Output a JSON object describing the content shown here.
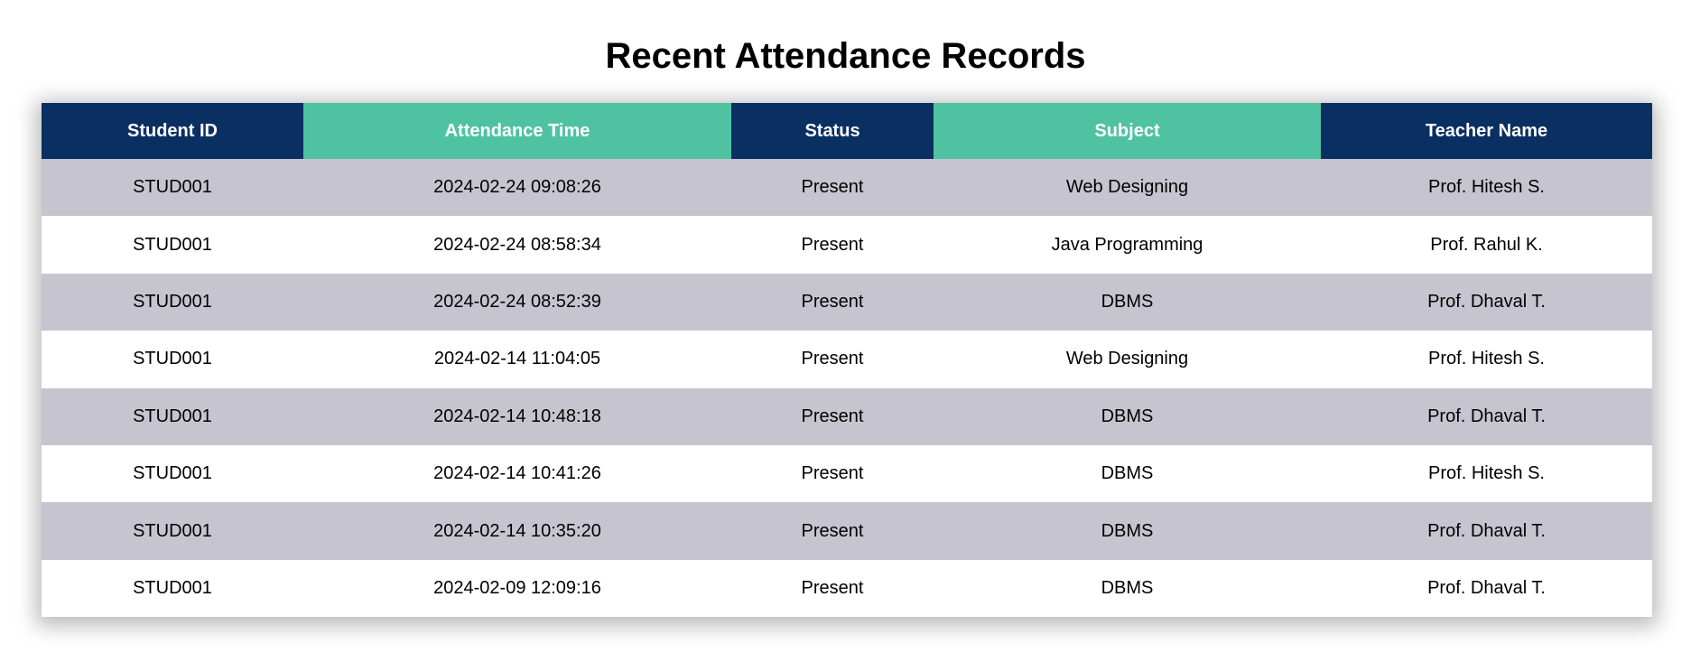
{
  "page": {
    "title": "Recent Attendance Records"
  },
  "colors": {
    "header_dark": "#0a2f63",
    "header_teal": "#4fc3a1",
    "row_shaded": "#c6c5cf",
    "row_plain": "#ffffff"
  },
  "table": {
    "columns": [
      "Student ID",
      "Attendance Time",
      "Status",
      "Subject",
      "Teacher Name"
    ],
    "rows": [
      [
        "STUD001",
        "2024-02-24 09:08:26",
        "Present",
        "Web Designing",
        "Prof. Hitesh S."
      ],
      [
        "STUD001",
        "2024-02-24 08:58:34",
        "Present",
        "Java Programming",
        "Prof. Rahul K."
      ],
      [
        "STUD001",
        "2024-02-24 08:52:39",
        "Present",
        "DBMS",
        "Prof. Dhaval T."
      ],
      [
        "STUD001",
        "2024-02-14 11:04:05",
        "Present",
        "Web Designing",
        "Prof. Hitesh S."
      ],
      [
        "STUD001",
        "2024-02-14 10:48:18",
        "Present",
        "DBMS",
        "Prof. Dhaval T."
      ],
      [
        "STUD001",
        "2024-02-14 10:41:26",
        "Present",
        "DBMS",
        "Prof. Hitesh S."
      ],
      [
        "STUD001",
        "2024-02-14 10:35:20",
        "Present",
        "DBMS",
        "Prof. Dhaval T."
      ],
      [
        "STUD001",
        "2024-02-09 12:09:16",
        "Present",
        "DBMS",
        "Prof. Dhaval T."
      ]
    ]
  }
}
